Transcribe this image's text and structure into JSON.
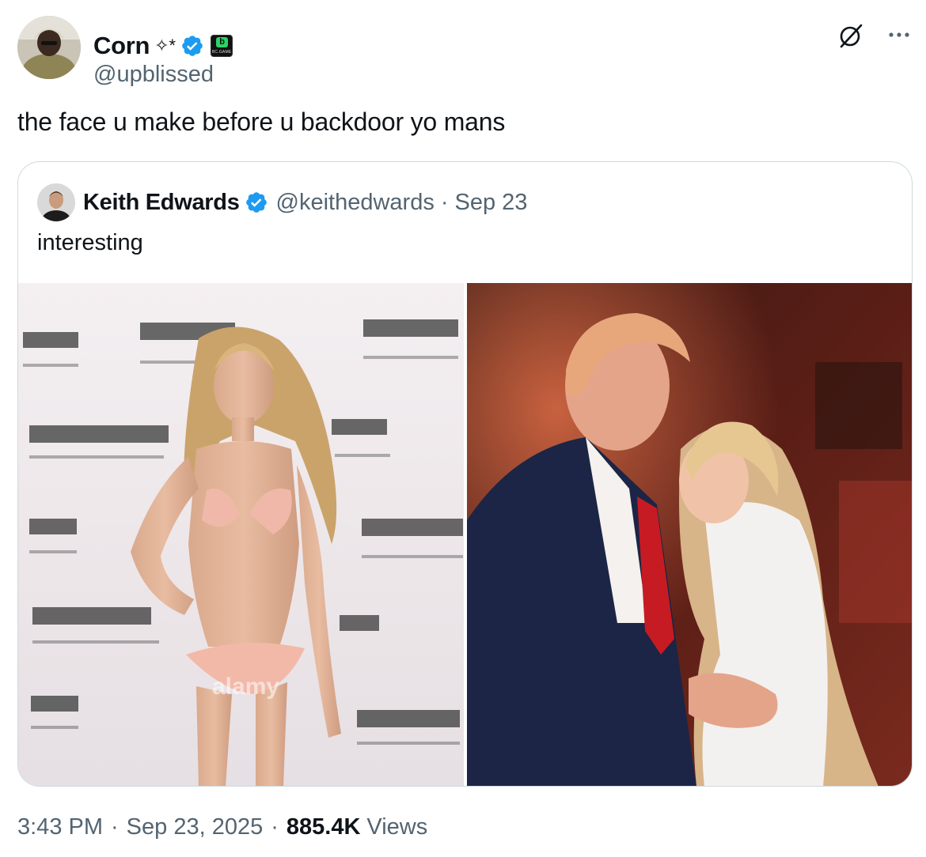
{
  "author": {
    "display_name": "Corn",
    "name_decoration": "✧*",
    "handle": "@upblissed",
    "affiliation_badge_text": "BC.GAME",
    "avatar_icon": "user-avatar-photo"
  },
  "tweet": {
    "text": "the face u make before u backdoor yo mans"
  },
  "quoted": {
    "display_name": "Keith Edwards",
    "handle": "@keithedwards",
    "separator": "·",
    "date": "Sep 23",
    "text": "interesting",
    "watermark": "alamy"
  },
  "meta": {
    "time": "3:43 PM",
    "separator": "·",
    "date": "Sep 23, 2025",
    "views_count": "885.4K",
    "views_label": "Views"
  },
  "colors": {
    "text_primary": "#0f1419",
    "text_secondary": "#536471",
    "verified_blue": "#1d9bf0",
    "border": "#cfd9de"
  },
  "icons": [
    "grok-icon",
    "more-icon",
    "verified-badge-icon"
  ]
}
